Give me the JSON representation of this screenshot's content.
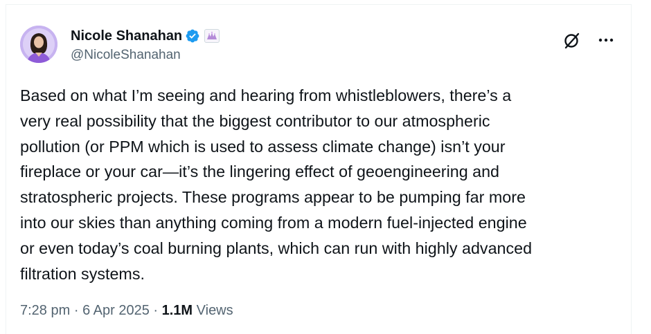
{
  "author": {
    "display_name": "Nicole Shanahan",
    "handle": "@NicoleShanahan",
    "verified": true
  },
  "tweet": {
    "text": "Based on what I’m seeing and hearing from whistleblowers, there’s a\nvery real possibility that the biggest contributor to our atmospheric\npollution (or PPM which is used to assess climate change) isn’t your\nfireplace or your car—it’s the lingering effect of geoengineering and\nstratospheric projects. These programs appear to be pumping far more\ninto our skies than anything coming from a modern fuel-injected engine\nor even today’s coal burning plants, which can run with highly advanced\nfiltration systems."
  },
  "meta": {
    "time": "7:28 pm",
    "separator": "·",
    "date": "6 Apr 2025",
    "views_count": "1.1M",
    "views_label": "Views"
  },
  "icons": {
    "verified": "verified-badge-icon",
    "affiliate": "affiliate-badge-icon",
    "grok": "grok-icon",
    "more": "more-options-icon"
  },
  "colors": {
    "verified_blue": "#1d9bf0",
    "text_primary": "#0f1419",
    "text_secondary": "#536471",
    "avatar_purple": "#8e5bd8"
  }
}
